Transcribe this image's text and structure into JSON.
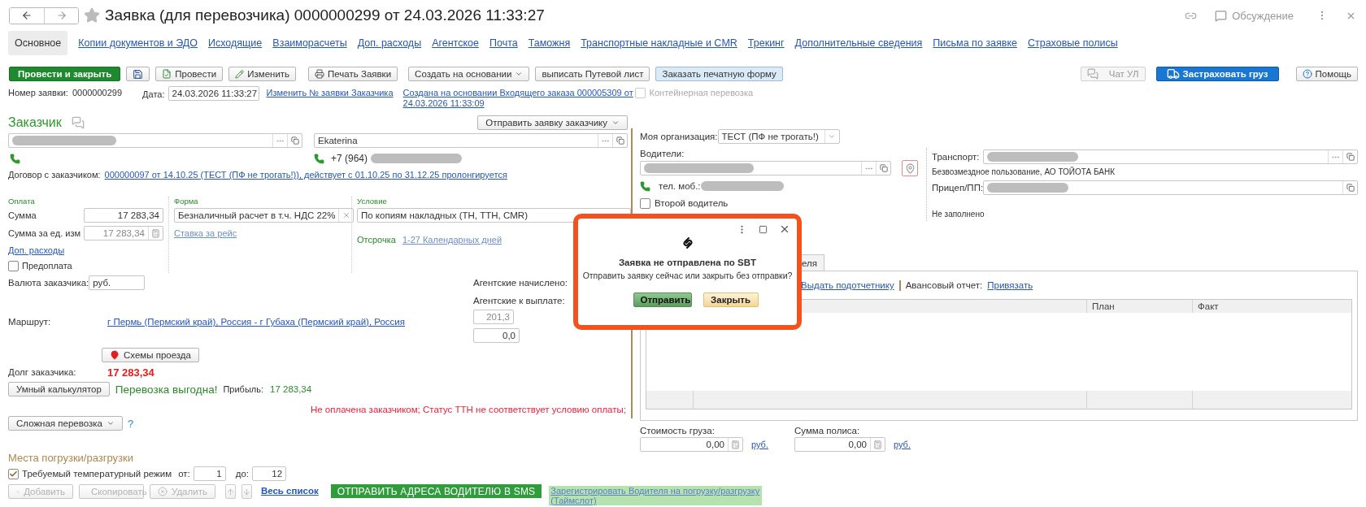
{
  "window": {
    "title": "Заявка (для перевозчика) 0000000299 от 24.03.2026 11:33:27",
    "discussion": "Обсуждение"
  },
  "tabs": [
    {
      "label": "Основное",
      "selected": true
    },
    {
      "label": "Копии документов и ЭДО",
      "selected": false
    },
    {
      "label": "Исходящие",
      "selected": false
    },
    {
      "label": "Взаиморасчеты",
      "selected": false
    },
    {
      "label": "Доп. расходы",
      "selected": false
    },
    {
      "label": "Агентское",
      "selected": false
    },
    {
      "label": "Почта",
      "selected": false
    },
    {
      "label": "Таможня",
      "selected": false
    },
    {
      "label": "Транспортные накладные и CMR",
      "selected": false
    },
    {
      "label": "Трекинг",
      "selected": false
    },
    {
      "label": "Дополнительные сведения",
      "selected": false
    },
    {
      "label": "Письма по заявке",
      "selected": false
    },
    {
      "label": "Страховые полисы",
      "selected": false
    }
  ],
  "toolbar": {
    "left": [
      {
        "label": "Провести и закрыть",
        "kind": "primary"
      },
      {
        "kind": "save"
      },
      {
        "label": "Провести",
        "kind": "post"
      },
      {
        "label": "Изменить",
        "kind": "edit"
      },
      {
        "label": "Печать Заявки",
        "kind": "print"
      },
      {
        "label": "Создать на основании",
        "kind": "menu"
      },
      {
        "label": "выписать Путевой лист",
        "kind": "plain"
      },
      {
        "label": "Заказать печатную форму",
        "kind": "accent"
      }
    ],
    "right": [
      {
        "label": "Чат УЛ",
        "kind": "chat",
        "disabled": true
      },
      {
        "label": "Застраховать груз",
        "kind": "insure",
        "disabled": false
      },
      {
        "label": "Помощь",
        "kind": "help",
        "disabled": false
      }
    ]
  },
  "header": {
    "number_label": "Номер заявки:",
    "number": "0000000299",
    "date_label": "Дата:",
    "date": "24.03.2026 11:33:27",
    "change_link": "Изменить № заявки Заказчика",
    "based_on_link": "Создана на основании Входящего заказа 000005309  от 24.03.2026 11:33:09",
    "container": {
      "label": "Контейнерная перевозка",
      "checked": false,
      "disabled": true
    }
  },
  "customer": {
    "title": "Заказчик",
    "send_button": "Отправить заявку заказчику",
    "contact": "Ekaterina",
    "phone_prefix": "+7 (964)",
    "contract_label": "Договор с заказчиком:",
    "contract_link": "000000097 от 14.10.25 (ТЕСТ (ПФ не трогать!)), действует с 01.10.25 по 31.12.25 пролонгируется"
  },
  "payment": {
    "pay_title": "Оплата",
    "form_title": "Форма",
    "condition_title": "Условие",
    "sum_label": "Сумма",
    "sum": "17 283,34",
    "unit_sum_label": "Сумма за ед. изм",
    "unit_sum": "17 283,34",
    "form": "Безналичный расчет в т.ч. НДС 22%",
    "rate_link": "Ставка за рейс",
    "condition": "По копиям накладных (ТН, ТТН, CMR)",
    "delay_label": "Отсрочка",
    "delay_link": "1-27 Календарных дней",
    "extra_link": "Доп. расходы",
    "prepay": {
      "label": "Предоплата",
      "checked": false
    },
    "currency_label": "Валюта заказчика:",
    "currency": "руб."
  },
  "agent": {
    "accrued_label": "Агентские начислено:",
    "payout_label": "Агентские к выплате:",
    "payout": "201,3",
    "fact": "0,0"
  },
  "route": {
    "label": "Маршрут:",
    "link": "г Пермь (Пермский край), Россия - г Губаха (Пермский край), Россия",
    "schemes_button": "Схемы проезда"
  },
  "debt": {
    "label": "Долг заказчика:",
    "value": "17 283,34"
  },
  "calc": {
    "button": "Умный калькулятор",
    "status": "Перевозка выгодна!",
    "profit_label": "Прибыль:",
    "profit": "17 283,34"
  },
  "warning": "Не оплачена заказчиком; Статус ТТН не соответствует условию оплаты;",
  "complex": {
    "button": "Сложная перевозка",
    "help": "?"
  },
  "places": {
    "title": "Места погрузки/разгрузки",
    "temperature": {
      "label": "Требуемый температурный режим",
      "checked": true
    },
    "from_label": "от:",
    "from": "1",
    "to_label": "до:",
    "to": "12",
    "buttons": [
      {
        "label": "Добавить",
        "kind": "add",
        "disabled": true
      },
      {
        "label": "Скопировать",
        "kind": "copy",
        "disabled": true
      },
      {
        "label": "Удалить",
        "kind": "delete",
        "disabled": true
      }
    ],
    "list_link": "Весь список",
    "sms_button": "ОТПРАВИТЬ АДРЕСА ВОДИТЕЛЮ В SMS",
    "register_link": "Зарегистрировать Водителя на погрузку/разгрузку (Таймслот)"
  },
  "carrier": {
    "org_label": "Моя организация:",
    "org": "ТЕСТ (ПФ не трогать!)",
    "drivers_label": "Водители:",
    "phone_label": "тел. моб.:",
    "second_driver": {
      "label": "Второй водитель",
      "checked": false
    },
    "transport_label": "Транспорт:",
    "transport_note": "Безвозмездное пользование, АО ТОЙОТА БАНК",
    "trailer_label": "Прицеп/ПП:",
    "trailer_note": "Не заполнено"
  },
  "advance": {
    "tab": "еля",
    "issue_link": "Выдать подотчетнику",
    "report_label": "Авансовый отчет:",
    "report_link": "Привязать",
    "columns": [
      "План",
      "Факт"
    ]
  },
  "cargo": {
    "cost_label": "Стоимость груза:",
    "cost": "0,00",
    "cost_currency": "руб.",
    "policy_label": "Сумма полиса:",
    "policy": "0,00",
    "policy_currency": "руб."
  },
  "dialog": {
    "title": "Заявка не отправлена по SBT",
    "message": "Отправить заявку сейчас или закрыть без отправки?",
    "buttons": [
      {
        "label": "Отправить",
        "kind": "primary"
      },
      {
        "label": "Закрыть",
        "kind": "secondary"
      }
    ]
  }
}
